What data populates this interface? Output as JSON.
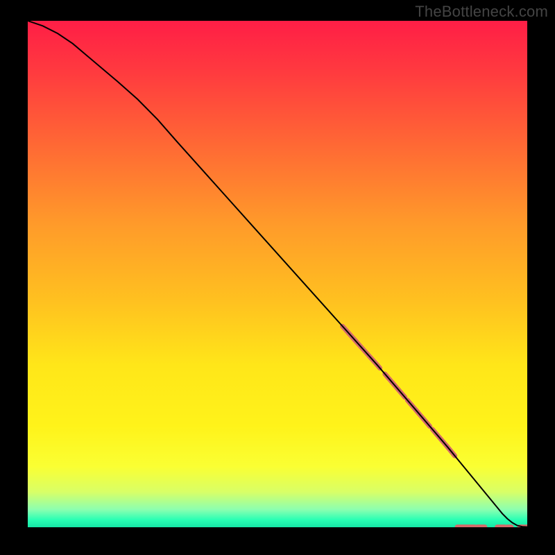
{
  "watermark": "TheBottleneck.com",
  "chart_data": {
    "type": "line",
    "title": "",
    "xlabel": "",
    "ylabel": "",
    "xlim": [
      0,
      100
    ],
    "ylim": [
      0,
      100
    ],
    "grid": false,
    "legend": false,
    "gradient_stops": [
      {
        "offset": 0.0,
        "color": "#ff1e46"
      },
      {
        "offset": 0.1,
        "color": "#ff3a3f"
      },
      {
        "offset": 0.25,
        "color": "#ff6a34"
      },
      {
        "offset": 0.4,
        "color": "#ff9a2a"
      },
      {
        "offset": 0.55,
        "color": "#ffc020"
      },
      {
        "offset": 0.68,
        "color": "#ffe619"
      },
      {
        "offset": 0.8,
        "color": "#fff31a"
      },
      {
        "offset": 0.88,
        "color": "#faff33"
      },
      {
        "offset": 0.93,
        "color": "#d9ff66"
      },
      {
        "offset": 0.965,
        "color": "#8cffb0"
      },
      {
        "offset": 0.985,
        "color": "#2affb4"
      },
      {
        "offset": 1.0,
        "color": "#15e6a6"
      }
    ],
    "series": [
      {
        "name": "curve",
        "color": "#000000",
        "width": 2,
        "x": [
          0,
          3,
          6,
          9,
          12,
          15,
          18,
          22,
          26,
          30,
          35,
          40,
          45,
          50,
          55,
          60,
          65,
          70,
          72,
          74,
          76,
          78,
          80,
          82,
          84,
          85,
          86,
          87,
          88,
          89,
          90,
          91,
          92,
          93,
          94,
          95,
          96,
          97,
          98,
          99,
          100
        ],
        "y": [
          100,
          99,
          97.5,
          95.5,
          93,
          90.5,
          88,
          84.5,
          80.5,
          76,
          70.5,
          65,
          59.5,
          54,
          48.5,
          43,
          37.5,
          32,
          29.7,
          27.4,
          25.1,
          22.8,
          20.5,
          18.2,
          15.9,
          14.7,
          13.5,
          12.3,
          11.1,
          9.9,
          8.7,
          7.5,
          6.3,
          5.1,
          3.9,
          2.7,
          1.7,
          0.9,
          0.35,
          0.1,
          0.05
        ]
      }
    ],
    "highlight_segments": {
      "color": "#d46a6a",
      "width": 7,
      "ranges": [
        [
          63,
          70.5
        ],
        [
          71.5,
          75.5
        ],
        [
          76,
          80.5
        ],
        [
          81,
          85.5
        ]
      ],
      "flat_dashes_x": [
        [
          86,
          89.5
        ],
        [
          90,
          91.5
        ],
        [
          94,
          95.5
        ],
        [
          96,
          96.8
        ],
        [
          98.5,
          99.2
        ],
        [
          99.6,
          100
        ]
      ]
    }
  }
}
